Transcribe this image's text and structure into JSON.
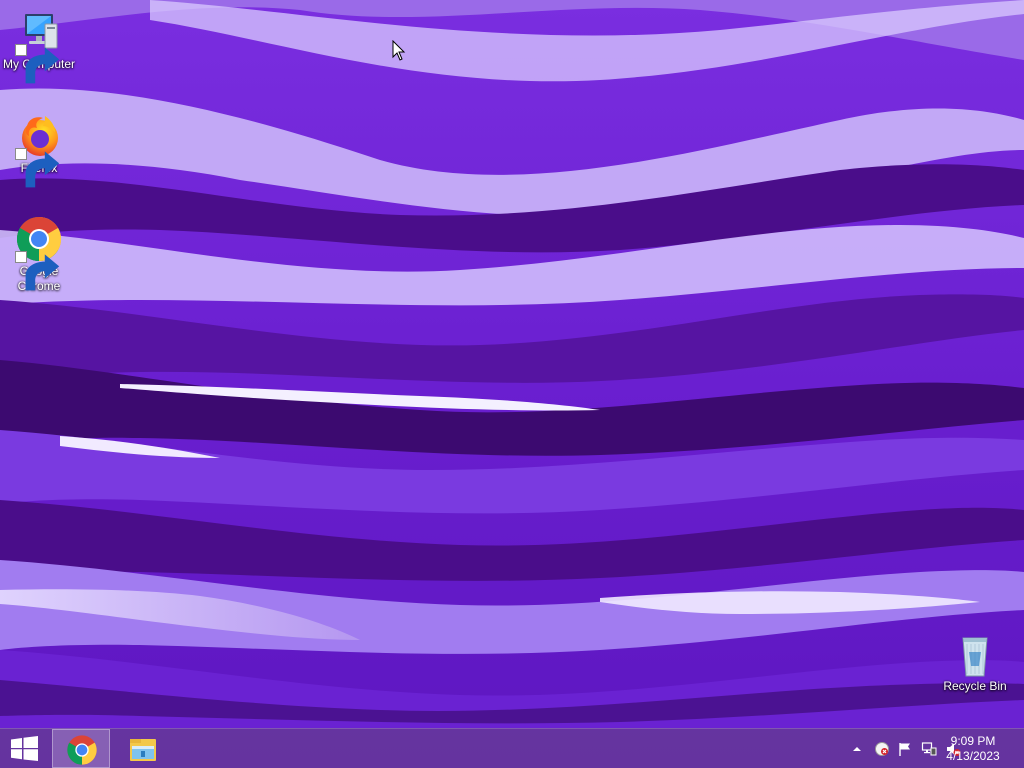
{
  "desktop": {
    "icons": [
      {
        "label": "My Computer",
        "icon": "computer-icon"
      },
      {
        "label": "Firefox",
        "icon": "firefox-icon"
      },
      {
        "label": "Google\nChrome",
        "icon": "chrome-icon"
      },
      {
        "label": "Recycle Bin",
        "icon": "recycle-bin-icon"
      }
    ]
  },
  "taskbar": {
    "start_icon": "windows-logo-icon",
    "pinned": [
      {
        "name": "Google Chrome",
        "icon": "chrome-icon",
        "active": true
      },
      {
        "name": "File Explorer",
        "icon": "file-explorer-icon",
        "active": false
      }
    ],
    "tray_icons": [
      "show-hidden-icons-chevron",
      "security-icon",
      "action-center-flag-icon",
      "network-icon",
      "volume-muted-icon"
    ],
    "clock": {
      "time": "9:09 PM",
      "date": "4/13/2023"
    }
  },
  "colors": {
    "wallpaper_base": "#6a1fd0",
    "wallpaper_dark": "#3e0a73",
    "wallpaper_light": "#c7b4f2",
    "taskbar": "#683c96"
  }
}
